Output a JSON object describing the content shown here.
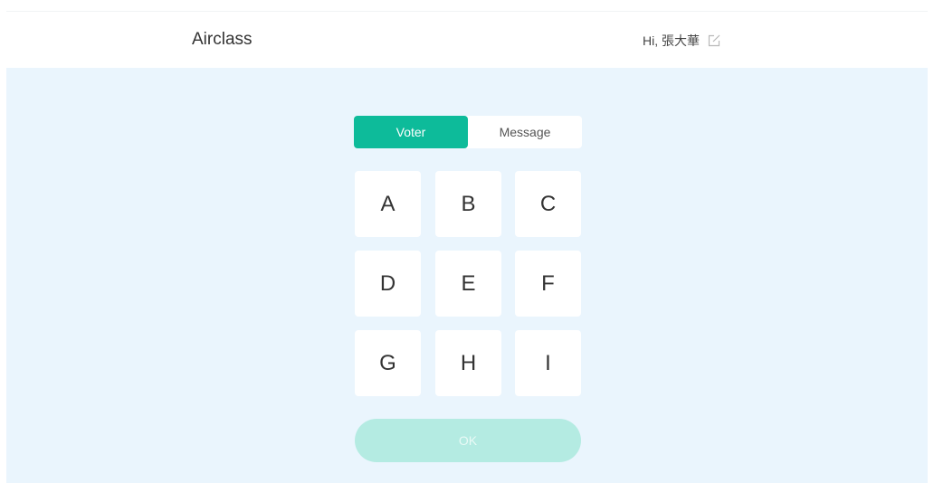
{
  "header": {
    "app_title": "Airclass",
    "greeting": "Hi, 張大華",
    "edit_icon": "edit-icon"
  },
  "tabs": [
    {
      "label": "Voter",
      "active": true
    },
    {
      "label": "Message",
      "active": false
    }
  ],
  "keypad": {
    "keys": [
      "A",
      "B",
      "C",
      "D",
      "E",
      "F",
      "G",
      "H",
      "I"
    ]
  },
  "ok_button": {
    "label": "OK",
    "enabled": false
  },
  "colors": {
    "accent": "#0dbb9a",
    "accent_disabled": "#b4ebe2",
    "background": "#eaf5fd"
  }
}
